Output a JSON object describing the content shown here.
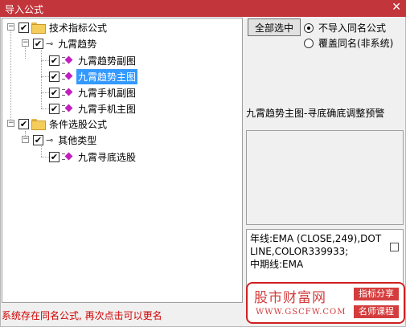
{
  "window": {
    "title": "导入公式",
    "close_glyph": "✕"
  },
  "tree": {
    "nodes": [
      {
        "label": "技术指标公式",
        "checked": true,
        "icon": "folder-icon"
      },
      {
        "label": "九霄趋势",
        "checked": true,
        "icon": "key-icon"
      },
      {
        "label": "九霄趋势副图",
        "checked": true,
        "icon": "formula-icon"
      },
      {
        "label": "九霄趋势主图",
        "checked": true,
        "icon": "formula-icon",
        "selected": true
      },
      {
        "label": "九霄手机副图",
        "checked": true,
        "icon": "formula-icon"
      },
      {
        "label": "九霄手机主图",
        "checked": true,
        "icon": "formula-icon"
      },
      {
        "label": "条件选股公式",
        "checked": true,
        "icon": "folder-icon"
      },
      {
        "label": "其他类型",
        "checked": true,
        "icon": "key-icon"
      },
      {
        "label": "九霄寻底选股",
        "checked": true,
        "icon": "formula-icon"
      }
    ],
    "expander_glyph": "−",
    "check_glyph": "✔"
  },
  "controls": {
    "select_all_label": "全部选中",
    "radio_no_import": "不导入同名公式",
    "radio_overwrite": "覆盖同名(非系统)",
    "selected_radio": "no_import"
  },
  "detail": {
    "description": "九霄趋势主图-寻底确底调整预警",
    "code_text": "年线:EMA (CLOSE,249),DOTLINE,COLOR339933;\n中期线:EMA"
  },
  "status_text": "系统存在同名公式, 再次点击可以更名",
  "watermark": {
    "title": "股市财富网",
    "url": "WWW.GSCFW.COM",
    "tag1": "指标分享",
    "tag2": "名师课程"
  },
  "colors": {
    "titlebar": "#c2353b",
    "status": "#d00000",
    "selection": "#3399ff",
    "formula_icon": "#c020c0"
  }
}
